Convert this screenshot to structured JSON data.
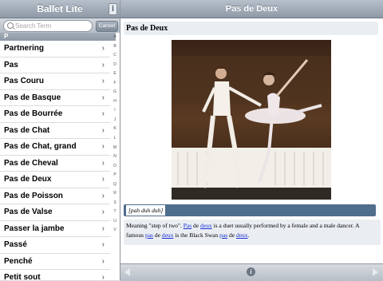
{
  "sidebar": {
    "title": "Ballet Lite",
    "info_glyph": "i",
    "search": {
      "placeholder": "Search Term",
      "cancel_label": "Cancel"
    },
    "section_header": "P",
    "items": [
      {
        "label": "Partnering"
      },
      {
        "label": "Pas"
      },
      {
        "label": "Pas Couru"
      },
      {
        "label": "Pas de Basque"
      },
      {
        "label": "Pas de Bourrée"
      },
      {
        "label": "Pas de Chat"
      },
      {
        "label": "Pas de Chat, grand"
      },
      {
        "label": "Pas de Cheval"
      },
      {
        "label": "Pas de Deux"
      },
      {
        "label": "Pas de Poisson"
      },
      {
        "label": "Pas de Valse"
      },
      {
        "label": "Passer la jambe"
      },
      {
        "label": "Passé"
      },
      {
        "label": "Penché"
      },
      {
        "label": "Petit sout"
      }
    ],
    "chevron_glyph": "›",
    "index_letters": [
      "A",
      "B",
      "C",
      "D",
      "E",
      "F",
      "G",
      "H",
      "I",
      "J",
      "K",
      "L",
      "M",
      "N",
      "O",
      "P",
      "Q",
      "R",
      "S",
      "T",
      "U",
      "V"
    ]
  },
  "main": {
    "title": "Pas de Deux",
    "heading": "Pas de Deux",
    "pronunciation": "[pah duh duh]",
    "description": {
      "part1": "Meaning \"step of two\". ",
      "link1": "Pas",
      "part2": " de ",
      "link2": "deux",
      "part3": " is a duet usually performed by a female and a male dancer. A famous ",
      "link3": "pas",
      "part4": " de ",
      "link4": "deux",
      "part5": " is the Black Swan ",
      "link5": "pas",
      "part6": " de ",
      "link6": "deux",
      "part7": "."
    }
  },
  "toolbar": {
    "info_glyph": "i"
  },
  "colors": {
    "title_bar": "#a3adb9",
    "pronunciation_bar": "#4f6d8c",
    "link": "#1a2fd6",
    "panel_bg": "#eaeef2"
  },
  "icons": [
    "search-icon",
    "info-icon",
    "chevron-right-icon",
    "arrow-left-icon",
    "arrow-right-icon"
  ]
}
